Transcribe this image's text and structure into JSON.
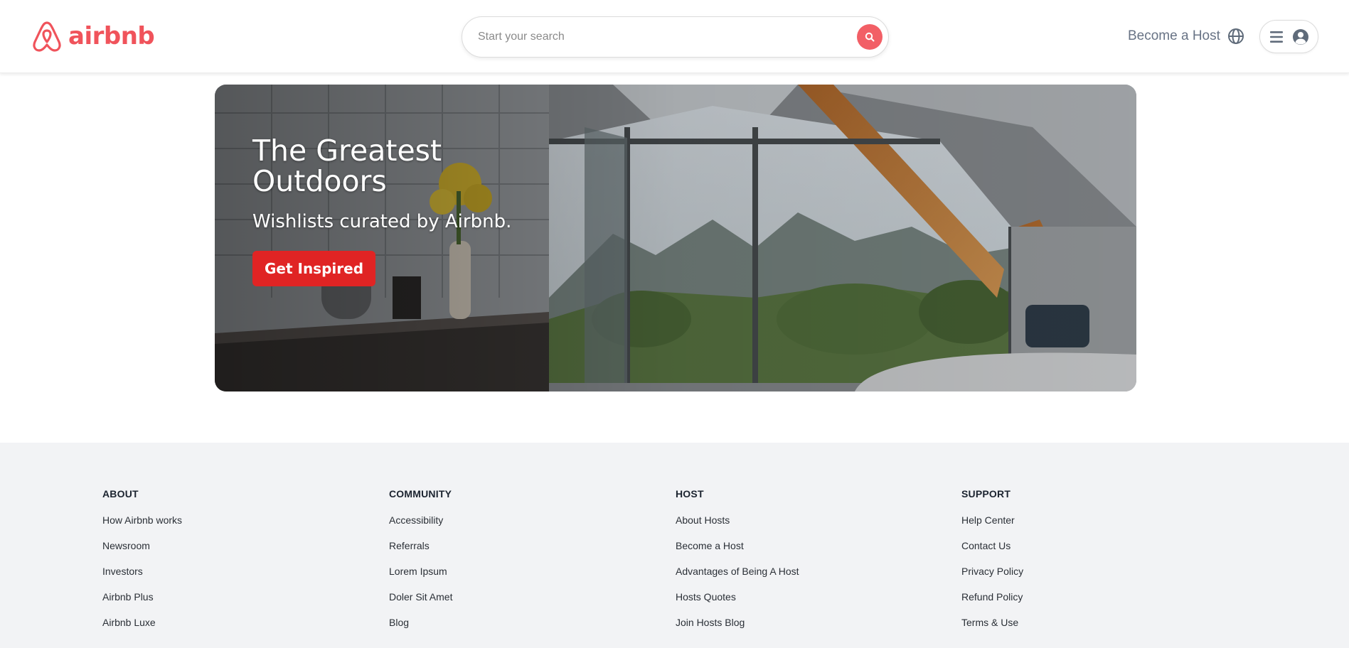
{
  "header": {
    "logo_text": "airbnb",
    "search_placeholder": "Start your search",
    "become_host": "Become a Host",
    "brand_color": "#f0535b"
  },
  "hero": {
    "title": "The Greatest Outdoors",
    "subtitle": "Wishlists curated by Airbnb.",
    "cta": "Get Inspired",
    "cta_color": "#e02424"
  },
  "footer": {
    "columns": [
      {
        "heading": "ABOUT",
        "links": [
          "How Airbnb works",
          "Newsroom",
          "Investors",
          "Airbnb Plus",
          "Airbnb Luxe"
        ]
      },
      {
        "heading": "COMMUNITY",
        "links": [
          "Accessibility",
          "Referrals",
          "Lorem Ipsum",
          "Doler Sit Amet",
          "Blog"
        ]
      },
      {
        "heading": "HOST",
        "links": [
          "About Hosts",
          "Become a Host",
          "Advantages of Being A Host",
          "Hosts Quotes",
          "Join Hosts Blog"
        ]
      },
      {
        "heading": "SUPPORT",
        "links": [
          "Help Center",
          "Contact Us",
          "Privacy Policy",
          "Refund Policy",
          "Terms & Use"
        ]
      }
    ]
  }
}
